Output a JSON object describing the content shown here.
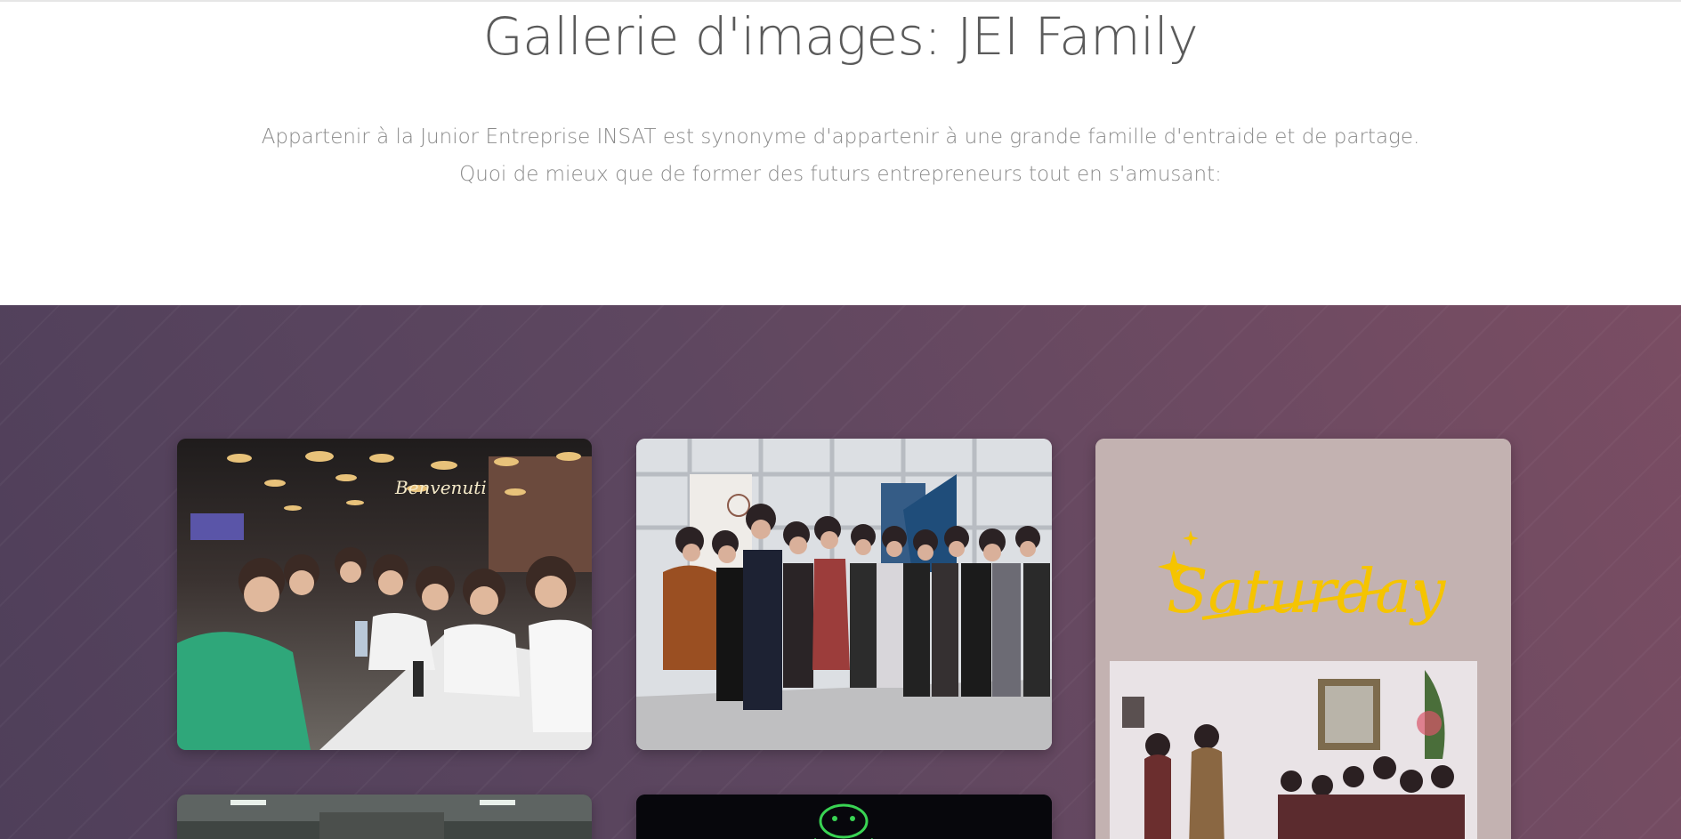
{
  "header": {
    "title": "Gallerie d'images: JEI Family",
    "description_line1": "Appartenir à la Junior Entreprise INSAT est synonyme d'appartenir à une grande famille d'entraide et de partage.",
    "description_line2": "Quoi de mieux que de former des futurs entrepreneurs tout en s'amusant:"
  },
  "gallery": {
    "images": [
      {
        "name": "photo-restaurant-group",
        "sign_text": "Benvenuti"
      },
      {
        "name": "photo-event-stand-group"
      },
      {
        "name": "photo-saturday-story",
        "overlay_text": "Saturday"
      },
      {
        "name": "photo-indoor-partial"
      },
      {
        "name": "photo-neon-partial"
      }
    ]
  },
  "colors": {
    "title": "#5a5a5a",
    "description": "#8a8a8a",
    "gallery_bg_start": "#4f3f5a",
    "gallery_bg_end": "#7a4d63",
    "saturday_yellow": "#f5c400"
  }
}
